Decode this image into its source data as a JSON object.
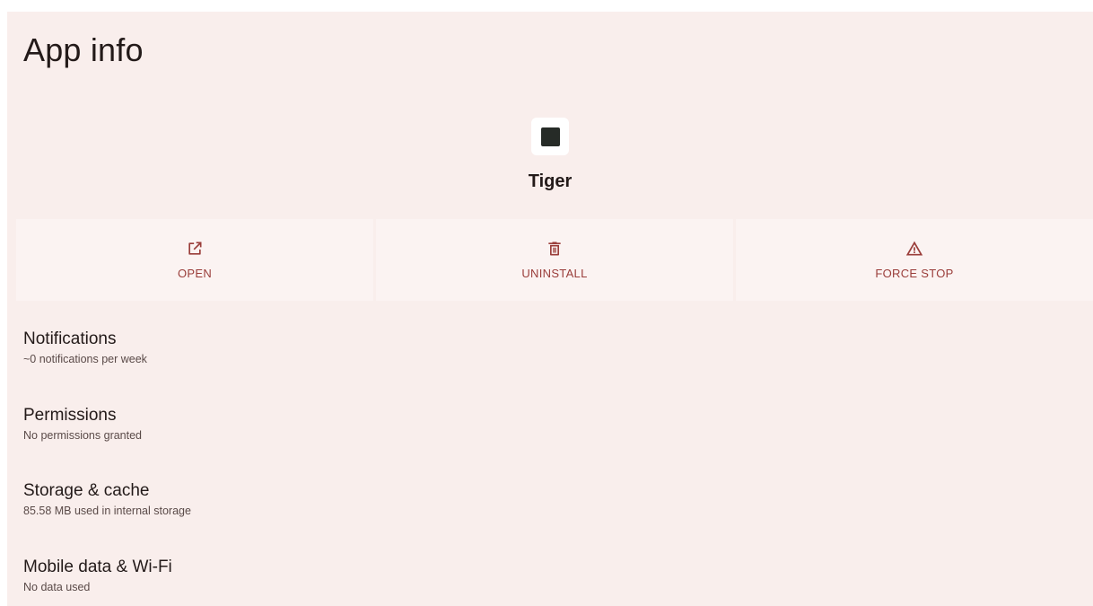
{
  "page": {
    "title": "App info"
  },
  "app": {
    "name": "Tiger",
    "icon": "app-icon"
  },
  "actions": [
    {
      "label": "OPEN",
      "icon": "open-in-new-icon"
    },
    {
      "label": "UNINSTALL",
      "icon": "trash-icon"
    },
    {
      "label": "FORCE STOP",
      "icon": "warning-icon"
    }
  ],
  "settings": [
    {
      "title": "Notifications",
      "subtitle": "~0 notifications per week"
    },
    {
      "title": "Permissions",
      "subtitle": "No permissions granted"
    },
    {
      "title": "Storage & cache",
      "subtitle": "85.58 MB used in internal storage"
    },
    {
      "title": "Mobile data & Wi-Fi",
      "subtitle": "No data used"
    }
  ],
  "colors": {
    "background": "#f9eeec",
    "action_background": "#fbf3f2",
    "accent": "#9a3d3a",
    "text_primary": "#231a19",
    "text_secondary": "#5a4a48"
  }
}
